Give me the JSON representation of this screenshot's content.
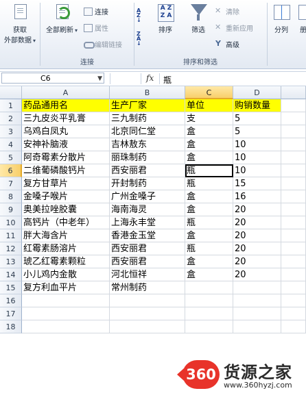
{
  "ribbon": {
    "get_external": {
      "line1": "获取",
      "line2": "外部数据"
    },
    "refresh_all": "全部刷新",
    "connections": "连接",
    "properties": "属性",
    "edit_links": "编辑链接",
    "group_connections": "连接",
    "sort": "排序",
    "filter": "筛选",
    "clear": "清除",
    "reapply": "重新应用",
    "advanced": "高级",
    "group_sort_filter": "排序和筛选",
    "text_to_columns": "分列",
    "cut_label": "册"
  },
  "formula_bar": {
    "name_box": "C6",
    "fx": "fx",
    "content": "瓶"
  },
  "sheet": {
    "columns": [
      "A",
      "B",
      "C",
      "D"
    ],
    "selected_column": "C",
    "selected_row": "6",
    "active_cell": "C6",
    "row_numbers": [
      "1",
      "2",
      "3",
      "4",
      "5",
      "6",
      "7",
      "8",
      "9",
      "10",
      "11",
      "12",
      "13",
      "14",
      "15",
      "16",
      "17",
      "18"
    ],
    "header": {
      "a": "药品通用名",
      "b": "生产厂家",
      "c": "单位",
      "d": "购销数量"
    },
    "rows": [
      {
        "a": "三九皮炎平乳膏",
        "b": "三九制药",
        "c": "支",
        "d": "5"
      },
      {
        "a": "乌鸡白凤丸",
        "b": "北京同仁堂",
        "c": "盒",
        "d": "5"
      },
      {
        "a": "安神补脑液",
        "b": "吉林敖东",
        "c": "盒",
        "d": "10"
      },
      {
        "a": "阿奇霉素分散片",
        "b": "丽珠制药",
        "c": "盒",
        "d": "10"
      },
      {
        "a": "二维葡磷酸钙片",
        "b": "西安丽君",
        "c": "瓶",
        "d": "10"
      },
      {
        "a": "复方甘草片",
        "b": "开封制药",
        "c": "瓶",
        "d": "15"
      },
      {
        "a": "金嗓子喉片",
        "b": "广州金嗓子",
        "c": "盒",
        "d": "16"
      },
      {
        "a": "奥美拉唑胶囊",
        "b": "海南海灵",
        "c": "盒",
        "d": "20"
      },
      {
        "a": "高钙片（中老年）",
        "b": "上海永丰堂",
        "c": "瓶",
        "d": "20"
      },
      {
        "a": "胖大海含片",
        "b": "香港金玉堂",
        "c": "盒",
        "d": "20"
      },
      {
        "a": "红霉素肠溶片",
        "b": "西安丽君",
        "c": "瓶",
        "d": "20"
      },
      {
        "a": "琥乙红霉素颗粒",
        "b": "西安丽君",
        "c": "盒",
        "d": "20"
      },
      {
        "a": "小儿鸡内金散",
        "b": "河北恒祥",
        "c": "盒",
        "d": "20"
      },
      {
        "a": "复方利血平片",
        "b": "常州制药",
        "c": "",
        "d": ""
      }
    ]
  },
  "watermark": {
    "badge": "360",
    "brand": "货源之家",
    "url": "www.360hyzj.com"
  },
  "colors": {
    "header_fill": "#ffff00",
    "selection": "#f8cf6a",
    "watermark_red": "#e8332a"
  }
}
